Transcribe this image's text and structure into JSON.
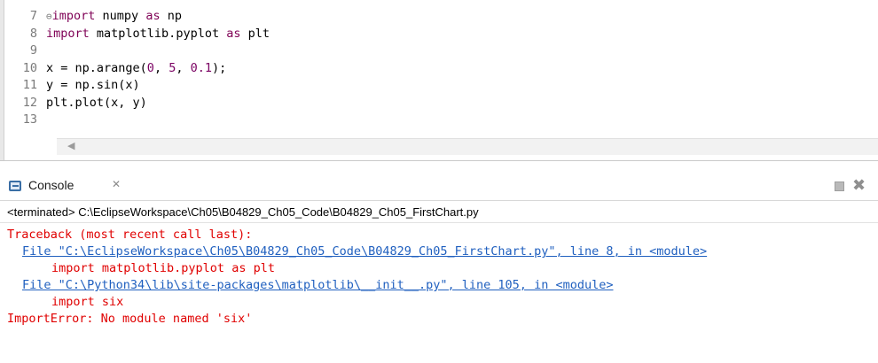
{
  "editor": {
    "lines": [
      {
        "num": "7",
        "fold": "⊖",
        "kw1": "import",
        "text1": " numpy ",
        "kw2": "as",
        "text2": " np"
      },
      {
        "num": "8",
        "kw1": "import",
        "text1": " matplotlib.pyplot ",
        "kw2": "as",
        "text2": " plt"
      },
      {
        "num": "9"
      },
      {
        "num": "10",
        "text1": "x = np.arange(",
        "n1": "0",
        "t2": ", ",
        "n2": "5",
        "t3": ", ",
        "n3": "0.1",
        "t4": ");"
      },
      {
        "num": "11",
        "text1": "y = np.sin(x)"
      },
      {
        "num": "12",
        "text1": "plt.plot(x, y)"
      },
      {
        "num": "13"
      }
    ],
    "scroll_left_arrow": "◀"
  },
  "console": {
    "title": "Console",
    "close_glyph": "✕",
    "status": "<terminated> C:\\EclipseWorkspace\\Ch05\\B04829_Ch05_Code\\B04829_Ch05_FirstChart.py",
    "output": [
      "Traceback (most recent call last):",
      "File \"C:\\EclipseWorkspace\\Ch05\\B04829_Ch05_Code\\B04829_Ch05_FirstChart.py\", line 8, in <module>",
      "import matplotlib.pyplot as plt",
      "File \"C:\\Python34\\lib\\site-packages\\matplotlib\\__init__.py\", line 105, in <module>",
      "import six",
      "ImportError: No module named 'six'"
    ]
  },
  "colors": {
    "keyword": "#7f0055",
    "number": "#7a0062",
    "error_text": "#e00000",
    "link": "#1f5fbf"
  },
  "icons": [
    "console-icon",
    "close-icon",
    "stop-icon",
    "remove-all-icon",
    "fold-icon",
    "scroll-left-icon"
  ]
}
